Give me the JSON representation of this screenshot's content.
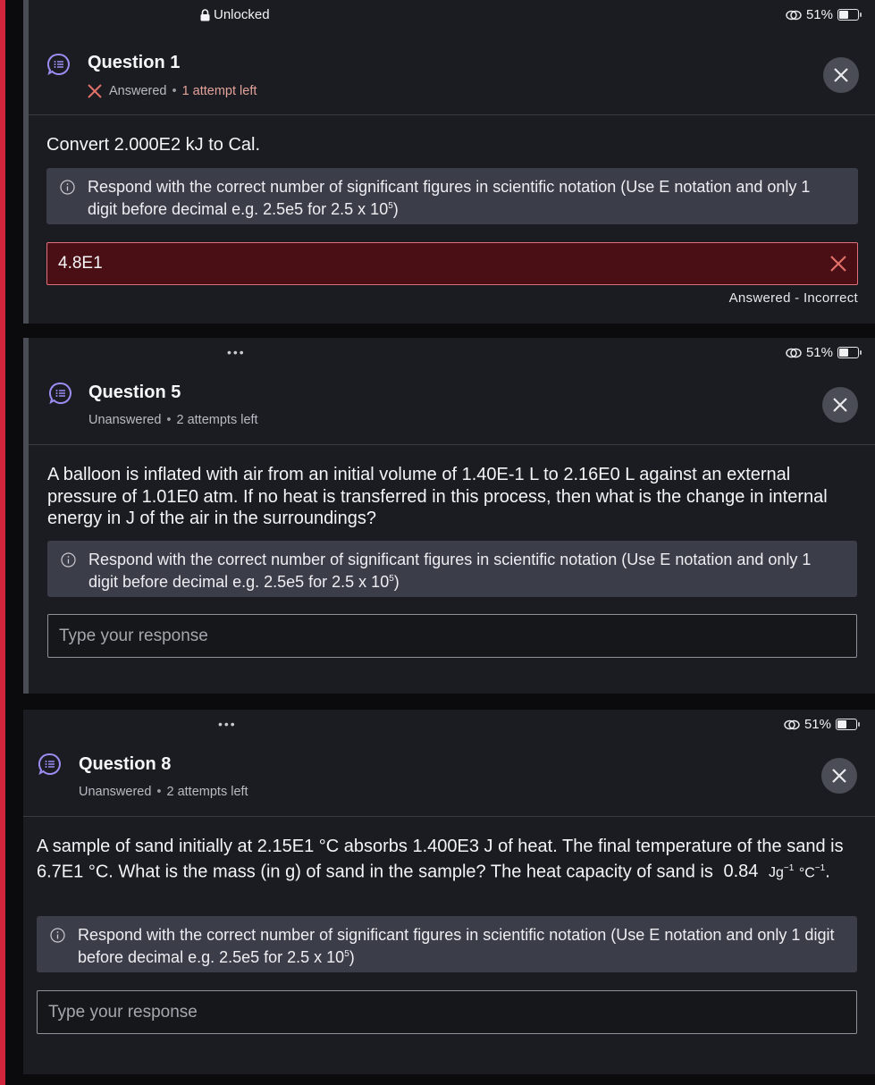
{
  "status": {
    "lock_label": "Unlocked",
    "battery": "51%",
    "battery_level": 0.51,
    "dots": "•••"
  },
  "hint_text": "Respond with the correct number of significant figures in scientific notation (Use E notation and only 1 digit before decimal e.g. 2.5e5 for 2.5 x 10",
  "hint_exp": "5",
  "hint_end": ")",
  "questions": [
    {
      "title": "Question 1",
      "status": "Answered",
      "sep": "•",
      "attempts": "1 attempt left",
      "text": "Convert 2.000E2 kJ to Cal.",
      "answer_value": "4.8E1",
      "result": "Answered - Incorrect"
    },
    {
      "title": "Question 5",
      "status": "Unanswered",
      "sep": "•",
      "attempts": "2 attempts left",
      "text": "A balloon is inflated with air from an initial volume of 1.40E-1 L to 2.16E0 L against an external pressure of 1.01E0 atm. If no heat is transferred in this process, then what is the change in internal energy in J of the air in the surroundings?",
      "placeholder": "Type your response"
    },
    {
      "title": "Question 8",
      "status": "Unanswered",
      "sep": "•",
      "attempts": "2 attempts left",
      "text_main": "A sample of sand initially at 2.15E1 °C absorbs 1.400E3 J of heat. The final temperature of the sand is 6.7E1 °C. What is the mass (in g) of sand in the sample? The heat capacity of sand is",
      "capacity_value": "0.84",
      "unit_jg": "Jg",
      "unit_c": "°C",
      "unit_exp": "−1",
      "unit_end": ".",
      "placeholder": "Type your response"
    }
  ],
  "colors": {
    "accent_red": "#d3243e",
    "incorrect_bg": "#4a0f14",
    "icon_purple": "#9b8cf2"
  }
}
